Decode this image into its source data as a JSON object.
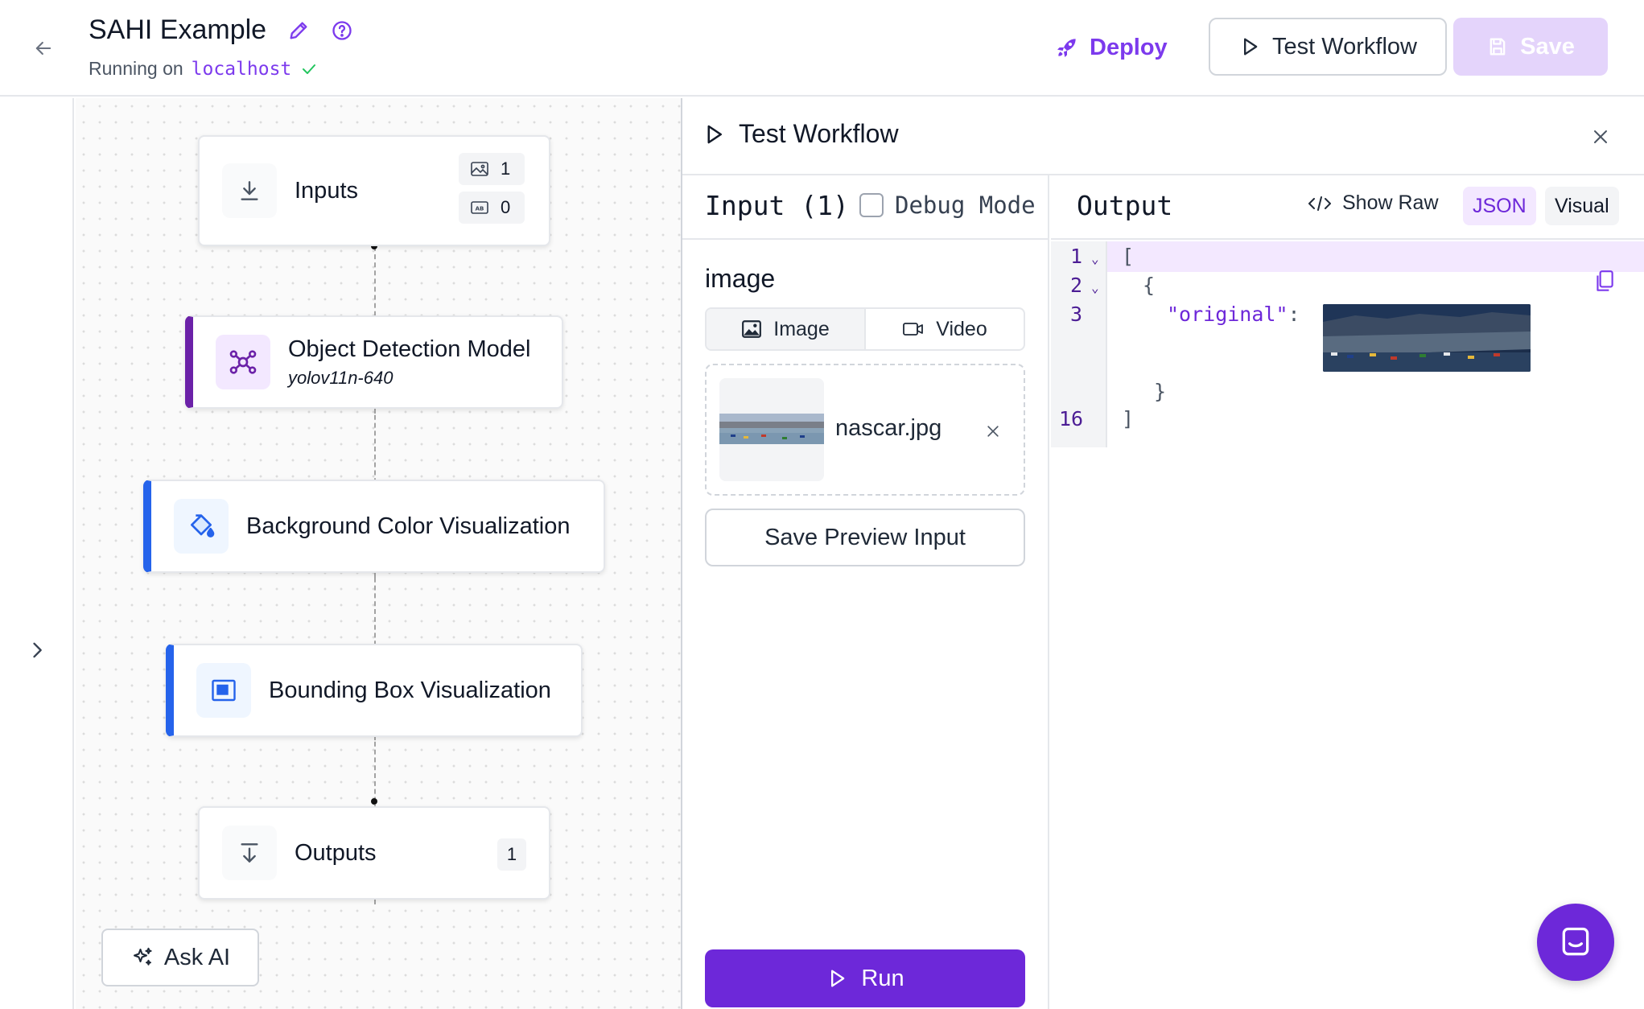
{
  "header": {
    "title": "SAHI Example",
    "running_prefix": "Running on",
    "running_host": "localhost",
    "deploy_label": "Deploy",
    "test_label": "Test Workflow",
    "save_label": "Save"
  },
  "nodes": {
    "inputs": {
      "label": "Inputs",
      "image_count": "1",
      "text_count": "0"
    },
    "detection": {
      "label": "Object Detection Model",
      "model": "yolov11n-640"
    },
    "bg_viz": {
      "label": "Background Color Visualization"
    },
    "bbox_viz": {
      "label": "Bounding Box Visualization"
    },
    "outputs": {
      "label": "Outputs",
      "count": "1"
    }
  },
  "ask_ai_label": "Ask AI",
  "panel": {
    "title": "Test Workflow",
    "input_title": "Input (1)",
    "debug_label": "Debug Mode",
    "field_label": "image",
    "toggle_image": "Image",
    "toggle_video": "Video",
    "file_name": "nascar.jpg",
    "save_preview_label": "Save Preview Input",
    "run_label": "Run",
    "output_title": "Output",
    "show_raw_label": "Show Raw",
    "view_json": "JSON",
    "view_visual": "Visual",
    "code": {
      "line_numbers": [
        "1",
        "2",
        "3",
        "16"
      ],
      "open_bracket": "[",
      "open_brace": "{",
      "key": "\"original\"",
      "colon": ":",
      "close_brace": "}",
      "close_bracket": "]"
    }
  },
  "colors": {
    "accent": "#6d28d9",
    "accent_light": "#f3e8ff",
    "detection_accent": "#6b21a8",
    "viz_accent": "#2563eb"
  },
  "icons": [
    "arrow-left-icon",
    "pencil-icon",
    "help-circle-icon",
    "check-icon",
    "rocket-icon",
    "play-icon",
    "save-icon",
    "chevron-right-icon",
    "download-icon",
    "image-icon",
    "text-box-icon",
    "network-icon",
    "paint-bucket-icon",
    "bounding-box-icon",
    "sparkles-icon",
    "close-icon",
    "video-icon",
    "code-icon",
    "copy-icon",
    "chat-icon"
  ]
}
